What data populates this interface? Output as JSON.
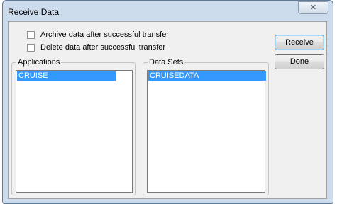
{
  "window": {
    "title": "Receive Data",
    "close_glyph": "✕"
  },
  "options": {
    "archive_label": "Archive data after successful transfer",
    "archive_checked": false,
    "delete_label": "Delete data after successful transfer",
    "delete_checked": false
  },
  "applications": {
    "label": "Applications",
    "items": [
      "CRUISE"
    ],
    "selected": "CRUISE"
  },
  "data_sets": {
    "label": "Data Sets",
    "items": [
      "CRUISEDATA"
    ],
    "selected": "CRUISEDATA"
  },
  "buttons": {
    "receive": "Receive",
    "done": "Done"
  },
  "colors": {
    "selection": "#3399ff",
    "frame": "#cddcec"
  }
}
